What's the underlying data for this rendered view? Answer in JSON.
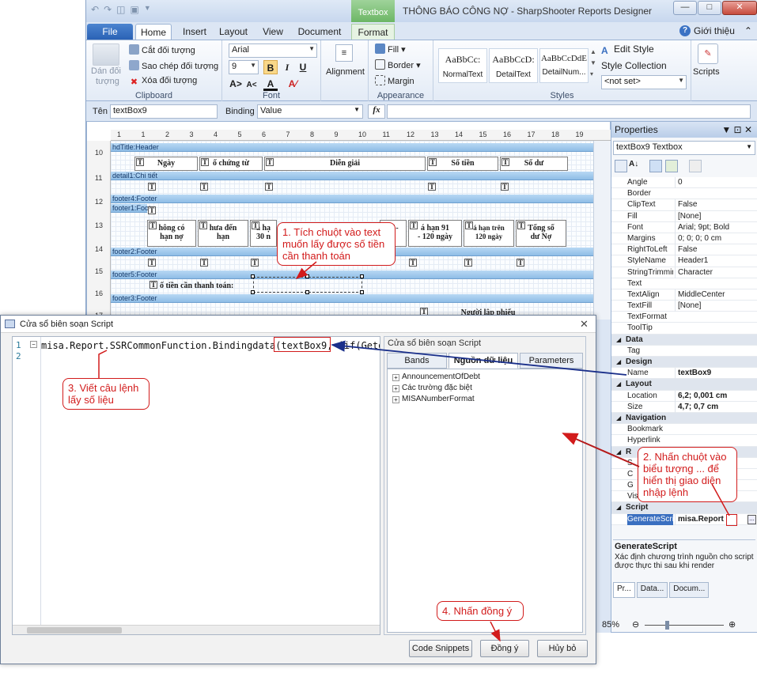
{
  "window": {
    "title": "THÔNG BÁO CÔNG NỢ - SharpShooter Reports Designer",
    "context_tab": "Textbox"
  },
  "ribbon": {
    "tabs": [
      "File",
      "Home",
      "Insert",
      "Layout",
      "View",
      "Document",
      "Format"
    ],
    "help_label": "Giới thiệu",
    "clipboard": {
      "paste_label_1": "Dán đối",
      "paste_label_2": "tượng",
      "cut": "Cắt đối tượng",
      "copy": "Sao chép đối tượng",
      "delete": "Xóa đối tượng",
      "group": "Clipboard"
    },
    "font": {
      "name": "Arial",
      "size": "9",
      "bold": "B",
      "italic": "I",
      "underline": "U",
      "group": "Font"
    },
    "alignment": {
      "label": "Alignment"
    },
    "appearance": {
      "fill": "Fill",
      "border": "Border",
      "margin": "Margin",
      "group": "Appearance"
    },
    "styles": {
      "items": [
        {
          "sample": "AaBbCc:",
          "name": "NormalText"
        },
        {
          "sample": "AaBbCcD:",
          "name": "DetailText"
        },
        {
          "sample": "AaBbCcDdE",
          "name": "DetailNum..."
        }
      ],
      "edit_style": "Edit Style",
      "style_collection": "Style Collection",
      "not_set": "<not set>",
      "group": "Styles"
    },
    "scripts": {
      "label": "Scripts"
    }
  },
  "bindbar": {
    "name_label": "Tên",
    "name_value": "textBox9",
    "binding_label": "Binding",
    "binding_value": "Value",
    "fx": "fx"
  },
  "designer": {
    "ruler_numbers": [
      "1",
      "1",
      "2",
      "3",
      "4",
      "5",
      "6",
      "7",
      "8",
      "9",
      "10",
      "11",
      "12",
      "13",
      "14",
      "15",
      "16",
      "17",
      "18",
      "19"
    ],
    "row_numbers": [
      "10",
      "11",
      "12",
      "13",
      "14",
      "15",
      "16",
      "17"
    ],
    "bands": {
      "header": "hdTitle:Header",
      "detail": "detail1:Chi tiết",
      "footer4": "footer4:Footer",
      "footer1": "footer1:Foot",
      "footer2": "footer2:Footer",
      "footer5": "footer5:Footer",
      "footer3": "footer3:Footer"
    },
    "header_cells": [
      "Ngày",
      "ố chứng từ",
      "Diễn giải",
      "Số tiền",
      "Số dư"
    ],
    "aging_cells": [
      "hông có\nhạn nợ",
      "hưa đến\nhạn",
      "á hạ\n30 n",
      "61-",
      "á hạn 91\n- 120 ngày",
      "á hạn trên\n120 ngày",
      "Tổng số\ndư Nợ"
    ],
    "total_label": "ố tiền cần thanh toán:",
    "signature_partial": "Người lập phiếu"
  },
  "properties": {
    "title": "Properties",
    "object": "textBox9 Textbox",
    "rows": [
      {
        "n": "Angle",
        "v": "0"
      },
      {
        "n": "Border",
        "v": ""
      },
      {
        "n": "ClipText",
        "v": "False"
      },
      {
        "n": "Fill",
        "v": "[None]"
      },
      {
        "n": "Font",
        "v": "Arial; 9pt; Bold"
      },
      {
        "n": "Margins",
        "v": "0; 0; 0; 0 cm"
      },
      {
        "n": "RightToLeft",
        "v": "False"
      },
      {
        "n": "StyleName",
        "v": "Header1"
      },
      {
        "n": "StringTrimmin",
        "v": "Character"
      },
      {
        "n": "Text",
        "v": ""
      },
      {
        "n": "TextAlign",
        "v": "MiddleCenter"
      },
      {
        "n": "TextFill",
        "v": "[None]"
      },
      {
        "n": "TextFormat",
        "v": ""
      },
      {
        "n": "ToolTip",
        "v": ""
      },
      {
        "n": "Data",
        "v": "",
        "cat": true
      },
      {
        "n": "Tag",
        "v": ""
      },
      {
        "n": "Design",
        "v": "",
        "cat": true
      },
      {
        "n": "Name",
        "v": "textBox9",
        "bold": true
      },
      {
        "n": "Layout",
        "v": "",
        "cat": true
      },
      {
        "n": "Location",
        "v": "6,2; 0,001 cm",
        "bold": true
      },
      {
        "n": "Size",
        "v": "4,7; 0,7 cm",
        "bold": true
      },
      {
        "n": "Navigation",
        "v": "",
        "cat": true
      },
      {
        "n": "Bookmark",
        "v": ""
      },
      {
        "n": "Hyperlink",
        "v": ""
      },
      {
        "n": "R",
        "v": "",
        "cat": true
      },
      {
        "n": "S",
        "v": ""
      },
      {
        "n": "C",
        "v": ""
      },
      {
        "n": "G",
        "v": ""
      },
      {
        "n": "Visi",
        "v": ""
      },
      {
        "n": "Script",
        "v": "",
        "cat": true
      },
      {
        "n": "GenerateScri",
        "v": "misa.Report",
        "bold": true,
        "sel": true
      }
    ],
    "desc_title": "GenerateScript",
    "desc_text": "Xác định chương trình nguồn cho script được thực thi sau khi render",
    "tabs": [
      "Pr...",
      "Data...",
      "Docum..."
    ],
    "zoom": "85%"
  },
  "dialog": {
    "title": "Cửa sổ biên soạn Script",
    "line_numbers": [
      "1",
      "2"
    ],
    "code": "misa.Report.SSRCommonFunction.Bindingdata(textBox9, iif(Getd",
    "right_title": "Cửa sổ biên soạn Script",
    "tabs": [
      "Bands",
      "Nguồn dữ liệu",
      "Parameters"
    ],
    "tree": [
      "AnnouncementOfDebt",
      "Các trường đặc biệt",
      "MISANumberFormat"
    ],
    "buttons": {
      "snippets": "Code Snippets",
      "ok": "Đồng ý",
      "cancel": "Hủy bỏ"
    }
  },
  "annotations": {
    "step1": "1. Tích chuột vào text muốn lấy được số tiền cần thanh toán",
    "step2": "2. Nhấn chuột vào biểu tượng ... để hiển thị giao diện nhập lệnh",
    "step3": "3. Viết câu lệnh lấy số liệu",
    "step4": "4. Nhấn đồng ý"
  }
}
